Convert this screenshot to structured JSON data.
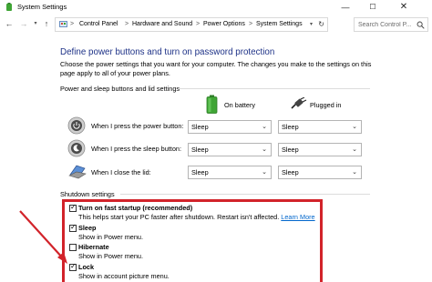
{
  "window": {
    "title": "System Settings",
    "minimize_glyph": "—",
    "maximize_glyph": "☐",
    "close_glyph": "✕"
  },
  "address_bar": {
    "crumbs": [
      "Control Panel",
      "Hardware and Sound",
      "Power Options",
      "System Settings"
    ],
    "separator": ">",
    "search_placeholder": "Search Control P..."
  },
  "page": {
    "heading": "Define power buttons and turn on password protection",
    "description": "Choose the power settings that you want for your computer. The changes you make to the settings on this page apply to all of your power plans."
  },
  "power_section": {
    "label": "Power and sleep buttons and lid settings",
    "col_battery": "On battery",
    "col_plugged": "Plugged in",
    "rows": [
      {
        "label": "When I press the power button:",
        "battery": "Sleep",
        "plugged": "Sleep"
      },
      {
        "label": "When I press the sleep button:",
        "battery": "Sleep",
        "plugged": "Sleep"
      },
      {
        "label": "When I close the lid:",
        "battery": "Sleep",
        "plugged": "Sleep"
      }
    ]
  },
  "shutdown_section": {
    "label": "Shutdown settings",
    "options": [
      {
        "label": "Turn on fast startup (recommended)",
        "checked": true,
        "desc": "This helps start your PC faster after shutdown. Restart isn't affected.",
        "link": "Learn More"
      },
      {
        "label": "Sleep",
        "checked": true,
        "desc": "Show in Power menu."
      },
      {
        "label": "Hibernate",
        "checked": false,
        "desc": "Show in Power menu."
      },
      {
        "label": "Lock",
        "checked": true,
        "desc": "Show in account picture menu."
      }
    ]
  },
  "icons": {
    "app": "power-options-icon",
    "battery": "battery-icon",
    "plug": "plug-icon",
    "power_button": "power-button-icon",
    "sleep_button": "sleep-button-icon",
    "lid": "laptop-lid-icon",
    "search": "search-icon",
    "check": "✓"
  },
  "colors": {
    "heading": "#1e3287",
    "highlight_border": "#d2232a",
    "link": "#0066cc",
    "battery_green": "#3fa535"
  }
}
